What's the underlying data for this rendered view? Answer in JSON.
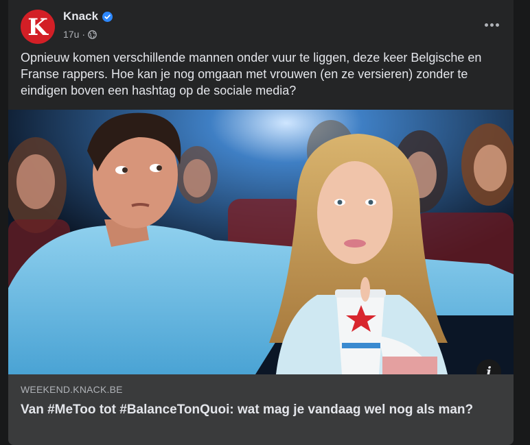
{
  "post": {
    "page_name": "Knack",
    "avatar_letter": "K",
    "time": "17u",
    "time_separator": "·",
    "text": "Opnieuw komen verschillende mannen onder vuur te liggen, deze keer Belgische en Franse rappers. Hoe kan je nog omgaan met vrouwen (en ze versieren) zonder te eindigen boven een hashtag op de sociale media?",
    "icons": {
      "verified": "verified-badge-icon",
      "audience": "globe-icon",
      "more": "more-options-icon",
      "info": "info-icon"
    }
  },
  "link_preview": {
    "domain": "WEEKEND.KNACK.BE",
    "title": "Van #MeToo tot #BalanceTonQuoi: wat mag je vandaag wel nog als man?"
  },
  "colors": {
    "brand_red": "#d31f26",
    "verified_blue": "#2d88ff",
    "card_bg": "#242526",
    "link_bg": "#3a3b3c"
  }
}
